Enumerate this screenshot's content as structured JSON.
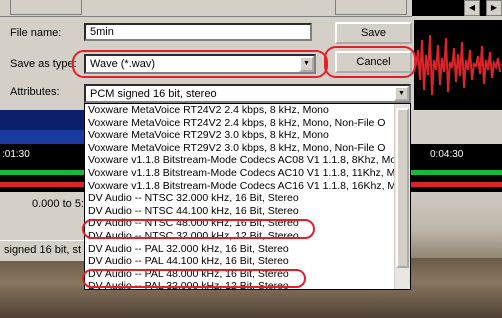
{
  "dialog": {
    "filename_label": "File name:",
    "filename_value": "5min",
    "saveas_label": "Save as type:",
    "saveas_value": "Wave (*.wav)",
    "attributes_label": "Attributes:",
    "attributes_value": "PCM signed 16 bit, stereo",
    "save_button": "Save",
    "cancel_button": "Cancel"
  },
  "dropdown": {
    "items": [
      "Voxware MetaVoice RT24V2  2.4 kbps, 8 kHz, Mono",
      "Voxware MetaVoice RT24V2  2.4 kbps, 8 kHz, Mono, Non-File O",
      "Voxware MetaVoice RT29V2  3.0 kbps, 8 kHz, Mono",
      "Voxware MetaVoice RT29V2  3.0 kbps, 8 kHz, Mono, Non-File O",
      "Voxware v1.1.8 Bitstream-Mode Codecs AC08 V1 1.1.8, 8Khz, Mo",
      "Voxware v1.1.8 Bitstream-Mode Codecs AC10 V1 1.1.8, 11Khz, M",
      "Voxware v1.1.8 Bitstream-Mode Codecs AC16 V1 1.1.8, 16Khz, M",
      "DV Audio -- NTSC 32.000 kHz, 16 Bit, Stereo",
      "DV Audio -- NTSC 44.100 kHz, 16 Bit, Stereo",
      "DV Audio -- NTSC 48.000 kHz, 16 Bit, Stereo",
      "DV Audio -- NTSC 32.000 kHz, 12 Bit, Stereo",
      "DV Audio -- PAL 32.000 kHz, 16 Bit, Stereo",
      "DV Audio -- PAL 44.100 kHz, 16 Bit, Stereo",
      "DV Audio -- PAL 48.000 kHz, 16 Bit, Stereo",
      "DV Audio -- PAL 32.000 kHz, 12 Bit, Stereo"
    ]
  },
  "background": {
    "time_left": ":01:30",
    "time_right": "0:04:30",
    "range_text": "0.000 to 5:0",
    "status_text": "signed 16 bit, st"
  },
  "colors": {
    "annotation_red": "#e0202a",
    "waveform_red": "#d8252c",
    "waveform_green": "#1ab83a",
    "dialog_gray": "#d4d0c8"
  },
  "icons": {
    "combo_arrow": "chevron-down-icon",
    "window_arrow": "chevron-icon"
  }
}
